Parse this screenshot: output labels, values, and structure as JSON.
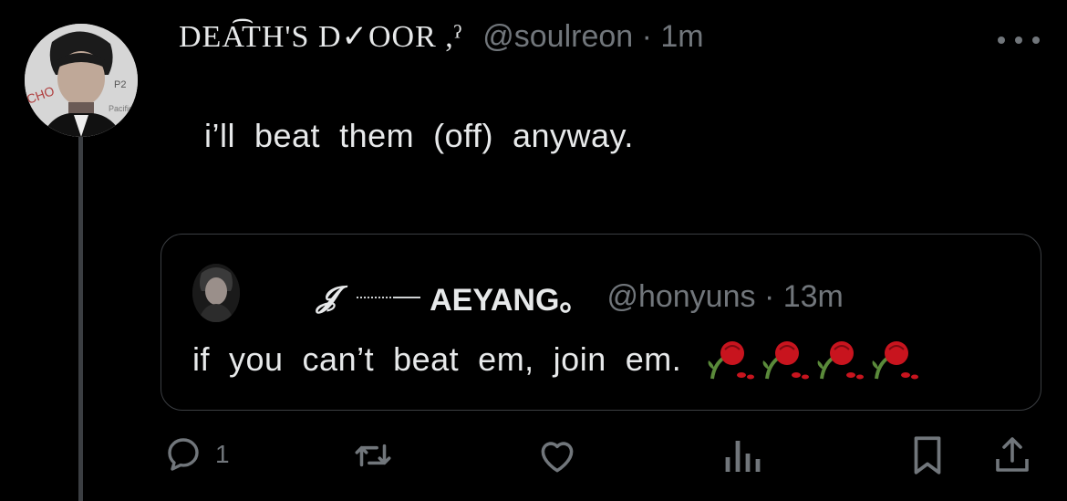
{
  "tweet": {
    "display_name": "DEA͡TH'S D✓OOR ,ˀ",
    "handle_time": "@soulreon · 1m",
    "text": "i’ll  beat  them  (off)  anyway."
  },
  "quote": {
    "glyph": "𝓙",
    "display_name": "AEYANG。",
    "handle_time": "@honyuns · 13m",
    "text": "if  you  can’t  beat  em,  join  em."
  },
  "actions": {
    "reply_count": "1",
    "icons": [
      "reply-icon",
      "retweet-icon",
      "like-icon",
      "views-icon",
      "bookmark-icon",
      "share-icon"
    ]
  },
  "colors": {
    "background": "#000000",
    "text": "#e7e9ea",
    "muted": "#71767b",
    "border": "#3b3e42",
    "rose": "#c8141e"
  }
}
